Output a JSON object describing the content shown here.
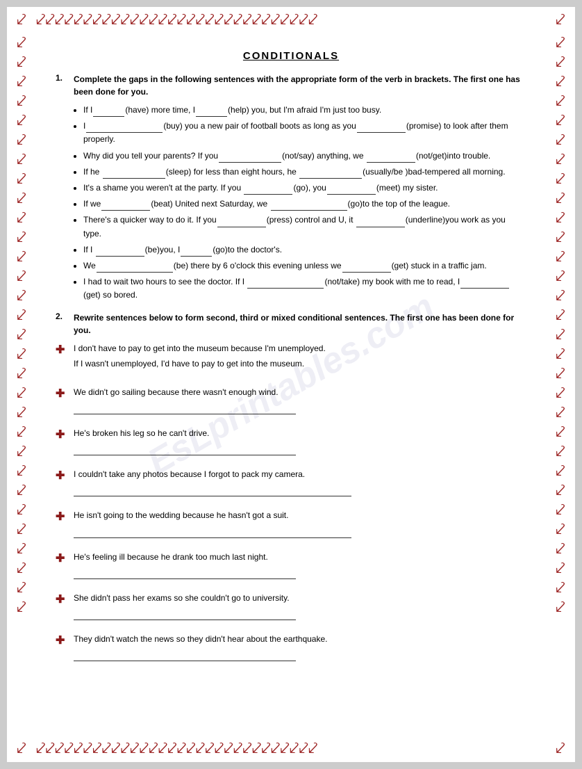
{
  "page": {
    "title": "CONDITIONALS",
    "watermark": "EsLprintables.com"
  },
  "section1": {
    "number": "1.",
    "instruction": "Complete the gaps in the following sentences with the appropriate form of the verb in brackets. The first one has been done for you.",
    "sentences": [
      "If I_______(have) more time, I_______(help) you, but I'm afraid I'm just too busy.",
      "I_____________(buy) you a new pair of football boots as long as you_______(promise) to look after them properly.",
      "Why did you tell your parents? If you____________(not/say) anything, we _______(not/get)into trouble.",
      "If he ____________(sleep) for less than eight hours, he __________(usually/be )bad-tempered all morning.",
      "It's a shame you weren't at the party. If you __________(go), you__________(meet) my sister.",
      "If we_________(beat) United next Saturday, we _____________(go)to the top of the league.",
      "There's a quicker way to do it. If you_________(press) control and U, it ________(underline)you work as you  type.",
      "If I __________(be)you, I_______(go)to the doctor's.",
      "We____________(be) there by 6 o'clock this evening unless we_________(get) stuck in a traffic jam.",
      "I had to wait two hours to see the doctor. If I _____________(not/take) my book with me to read, I________(get) so bored."
    ]
  },
  "section2": {
    "number": "2.",
    "instruction": "Rewrite sentences below to form second, third or mixed conditional sentences. The first one has been done for you.",
    "items": [
      {
        "sentence": "I don't have to pay to get into the museum because I'm unemployed.",
        "example": "If I wasn't unemployed, I'd have to pay to get into the museum.",
        "hasAnswer": true
      },
      {
        "sentence": "We didn't go sailing because there wasn't enough wind.",
        "example": "",
        "hasAnswer": true
      },
      {
        "sentence": "He's broken his leg so he can't drive.",
        "example": "",
        "hasAnswer": true
      },
      {
        "sentence": "I couldn't take any photos because I forgot to pack my camera.",
        "example": "",
        "hasAnswer": true,
        "longLine": true
      },
      {
        "sentence": "He isn't going to the wedding because he hasn't got a suit.",
        "example": "",
        "hasAnswer": true,
        "longLine": true
      },
      {
        "sentence": "He's feeling ill because he drank too much last night.",
        "example": "",
        "hasAnswer": true
      },
      {
        "sentence": "She didn't pass her exams so she couldn't go to university.",
        "example": "",
        "hasAnswer": true
      },
      {
        "sentence": "They didn't watch the news so they didn't hear about the earthquake.",
        "example": "",
        "hasAnswer": true
      }
    ]
  }
}
